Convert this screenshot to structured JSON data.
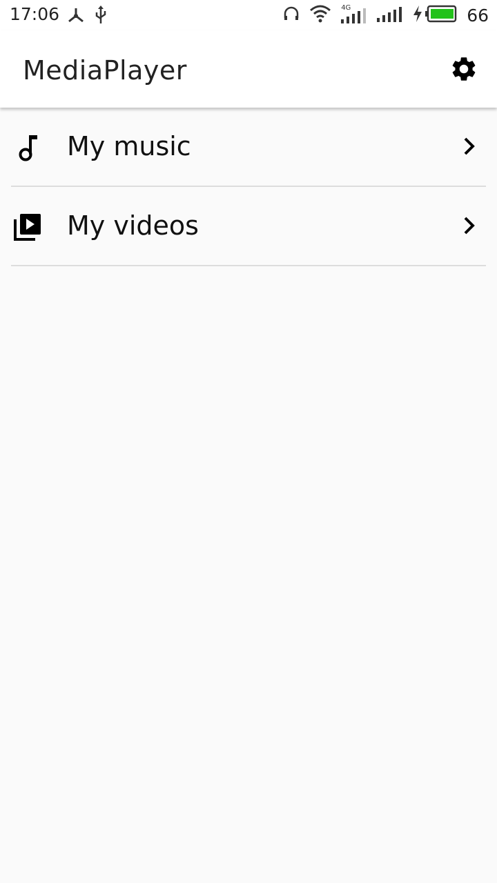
{
  "status_bar": {
    "time": "17:06",
    "battery_percent": "66",
    "network_label": "4G",
    "left_icons": [
      "usb-tether-icon",
      "usb-icon"
    ],
    "right_icons": [
      "headphones-icon",
      "wifi-icon",
      "signal-4g-icon",
      "signal-icon",
      "charging-icon",
      "battery-icon"
    ],
    "battery_color": "#22c21a"
  },
  "app_bar": {
    "title": "MediaPlayer",
    "settings_icon": "gear-icon"
  },
  "menu": {
    "items": [
      {
        "label": "My music",
        "icon": "music-note-icon"
      },
      {
        "label": "My videos",
        "icon": "video-library-icon"
      }
    ]
  },
  "colors": {
    "background": "#fafafa",
    "app_bar": "#ffffff",
    "divider": "#dcdcdc",
    "text": "#111111"
  }
}
